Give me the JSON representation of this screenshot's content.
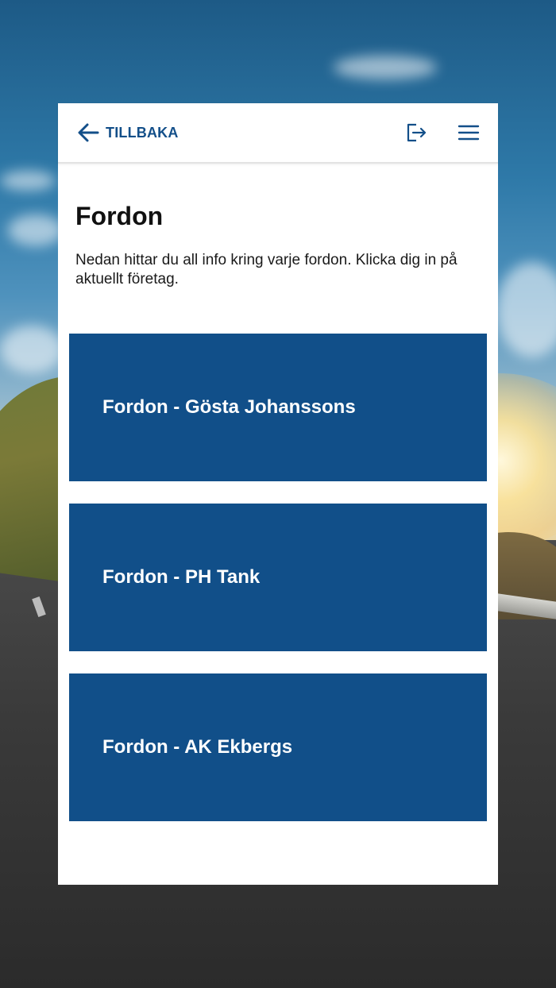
{
  "header": {
    "back_label": "TILLBAKA",
    "back_icon": "arrow-left-icon",
    "logout_icon": "logout-icon",
    "menu_icon": "hamburger-menu-icon"
  },
  "page": {
    "title": "Fordon",
    "description": "Nedan hittar du all info kring varje fordon. Klicka dig in på aktuellt företag."
  },
  "companies": [
    {
      "label": "Fordon - Gösta Johanssons"
    },
    {
      "label": "Fordon - PH Tank"
    },
    {
      "label": "Fordon - AK Ekbergs"
    }
  ],
  "colors": {
    "accent": "#134f89",
    "tile_background": "#114f89",
    "panel_background": "#ffffff"
  }
}
